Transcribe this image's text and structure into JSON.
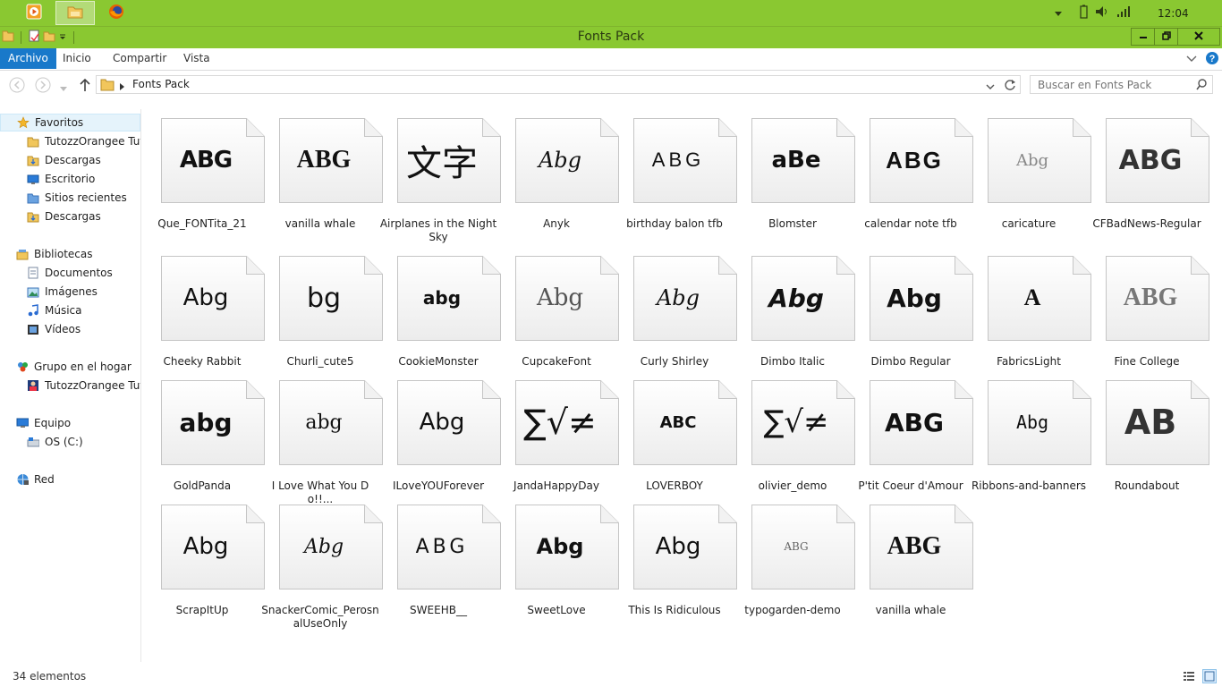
{
  "taskbar": {
    "buttons": [
      {
        "name": "media-player-icon"
      },
      {
        "name": "file-explorer-icon"
      },
      {
        "name": "firefox-icon"
      }
    ],
    "clock": "12:04"
  },
  "window": {
    "title": "Fonts Pack"
  },
  "ribbon": {
    "tabs": [
      "Archivo",
      "Inicio",
      "Compartir",
      "Vista"
    ]
  },
  "address": {
    "path": "Fonts Pack",
    "search_placeholder": "Buscar en Fonts Pack"
  },
  "nav": {
    "favorites": "Favoritos",
    "favorite_items": [
      "TutozzOrangee Tuto",
      "Descargas",
      "Escritorio",
      "Sitios recientes",
      "Descargas"
    ],
    "libraries": "Bibliotecas",
    "library_items": [
      "Documentos",
      "Imágenes",
      "Música",
      "Vídeos"
    ],
    "homegroup": "Grupo en el hogar",
    "homegroup_items": [
      "TutozzOrangee Tuto"
    ],
    "computer": "Equipo",
    "computer_items": [
      "OS (C:)"
    ],
    "network": "Red"
  },
  "files": [
    {
      "name": "Que_FONTita_21",
      "preview": "ABG"
    },
    {
      "name": "vanilla whale",
      "preview": "ABG"
    },
    {
      "name": "Airplanes in the Night Sky",
      "preview": "文字"
    },
    {
      "name": "Anyk",
      "preview": "Abg"
    },
    {
      "name": "birthday balon tfb",
      "preview": "ABG"
    },
    {
      "name": "Blomster",
      "preview": "aBe"
    },
    {
      "name": "calendar note tfb",
      "preview": "ABG"
    },
    {
      "name": "caricature",
      "preview": "Abg"
    },
    {
      "name": "CFBadNews-Regular",
      "preview": "ABG"
    },
    {
      "name": "Cheeky Rabbit",
      "preview": "Abg"
    },
    {
      "name": "Churli_cute5",
      "preview": "bg"
    },
    {
      "name": "CookieMonster",
      "preview": "abg"
    },
    {
      "name": "CupcakeFont",
      "preview": "Abg"
    },
    {
      "name": "Curly Shirley",
      "preview": "Abg"
    },
    {
      "name": "Dimbo Italic",
      "preview": "Abg"
    },
    {
      "name": "Dimbo Regular",
      "preview": "Abg"
    },
    {
      "name": "FabricsLight",
      "preview": "A"
    },
    {
      "name": "Fine College",
      "preview": "ABG"
    },
    {
      "name": "GoldPanda",
      "preview": "abg"
    },
    {
      "name": "I Love What You Do!!...",
      "preview": "abg"
    },
    {
      "name": "ILoveYOUForever",
      "preview": "Abg"
    },
    {
      "name": "JandaHappyDay",
      "preview": "∑√≠"
    },
    {
      "name": "LOVERBOY",
      "preview": "ABC"
    },
    {
      "name": "olivier_demo",
      "preview": "∑√≠"
    },
    {
      "name": "P'tit Coeur d'Amour",
      "preview": "ABG"
    },
    {
      "name": "Ribbons-and-banners",
      "preview": "Abg"
    },
    {
      "name": "Roundabout",
      "preview": "AB"
    },
    {
      "name": "ScrapItUp",
      "preview": "Abg"
    },
    {
      "name": "SnackerComic_PerosnalUseOnly",
      "preview": "Abg"
    },
    {
      "name": "SWEEHB__",
      "preview": "ABG"
    },
    {
      "name": "SweetLove",
      "preview": "Abg"
    },
    {
      "name": "This Is Ridiculous",
      "preview": "Abg"
    },
    {
      "name": "typogarden-demo",
      "preview": "ABG"
    },
    {
      "name": "vanilla whale",
      "preview": "ABG"
    }
  ],
  "status": {
    "count": "34 elementos"
  }
}
